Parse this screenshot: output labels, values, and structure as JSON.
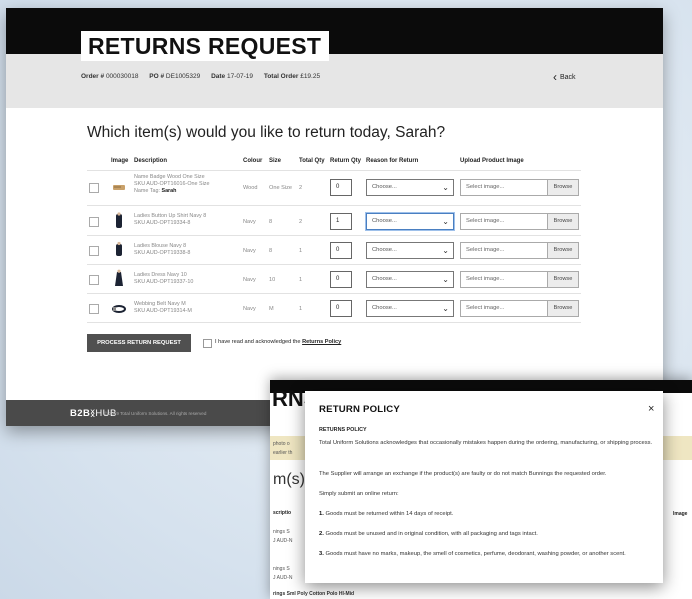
{
  "page": {
    "title": "RETURNS REQUEST"
  },
  "order_info": {
    "order_label": "Order #",
    "order_value": "000030018",
    "po_label": "PO #",
    "po_value": "DE1005329",
    "date_label": "Date",
    "date_value": "17-07-19",
    "total_label": "Total Order",
    "total_value": "£19.25"
  },
  "back_label": "Back",
  "question": "Which item(s) would you like to return today, Sarah?",
  "table": {
    "headers": [
      "Image",
      "Description",
      "Colour",
      "Size",
      "Total Qty",
      "Return Qty",
      "Reason for Return",
      "Upload Product Image"
    ],
    "rows": [
      {
        "desc1": "Name Badge Wood One Size",
        "desc2": "SKU AUD-OPT16016-One Size",
        "desc3_label": "Name Tag:",
        "desc3_value": "Sarah",
        "colour": "Wood",
        "size": "One Size",
        "total_qty": "2",
        "return_qty": "0",
        "reason": "Choose...",
        "active": false
      },
      {
        "desc1": "Ladies Button Up Shirt Navy 8",
        "desc2": "SKU AUD-OPT19334-8",
        "desc3_label": "",
        "desc3_value": "",
        "colour": "Navy",
        "size": "8",
        "total_qty": "2",
        "return_qty": "1",
        "reason": "Choose...",
        "active": true
      },
      {
        "desc1": "Ladies Blouse Navy 8",
        "desc2": "SKU AUD-OPT19338-8",
        "desc3_label": "",
        "desc3_value": "",
        "colour": "Navy",
        "size": "8",
        "total_qty": "1",
        "return_qty": "0",
        "reason": "Choose...",
        "active": false
      },
      {
        "desc1": "Ladies Dress Navy 10",
        "desc2": "SKU AUD-OPT19337-10",
        "desc3_label": "",
        "desc3_value": "",
        "colour": "Navy",
        "size": "10",
        "total_qty": "1",
        "return_qty": "0",
        "reason": "Choose...",
        "active": false
      },
      {
        "desc1": "Webbing Belt Navy M",
        "desc2": "SKU AUD-OPT19314-M",
        "desc3_label": "",
        "desc3_value": "",
        "colour": "Navy",
        "size": "M",
        "total_qty": "1",
        "return_qty": "0",
        "reason": "Choose...",
        "active": false
      }
    ],
    "upload_placeholder": "Select image...",
    "browse_label": "Browse"
  },
  "process_button": "PROCESS RETURN REQUEST",
  "ack_text": "I have read and acknowledged the",
  "ack_link": "Returns Policy",
  "footer": {
    "logo_b2b": "B2B",
    "logo_hub": "HUB",
    "copyright": "© 2019 Total Uniform Solutions. All rights reserved"
  },
  "background_window": {
    "heading_fragment": "RNS",
    "question_fragment": "m(s)",
    "col_fragment": "scriptio",
    "col_fragment_right": "Image",
    "strip_text_1": "photo o",
    "strip_text_2": "earlier th",
    "row_text_a": "nings S",
    "row_text_b": "J AUD-N",
    "bottom_text": "rings Sml Poly Cotton Polo HI-Mid"
  },
  "modal": {
    "title": "RETURN POLICY",
    "close": "×",
    "subtitle": "RETURNS POLICY",
    "paragraphs": [
      {
        "num": "",
        "text": "Total Uniform Solutions acknowledges that occasionally mistakes happen during the ordering, manufacturing, or shipping process."
      },
      {
        "num": "",
        "text": "The Supplier will arrange an exchange if the product(s) are faulty or do not match Bunnings the requested order."
      },
      {
        "num": "",
        "text": "Simply submit an online return:"
      },
      {
        "num": "1.",
        "text": "Goods must be returned within 14 days of receipt."
      },
      {
        "num": "2.",
        "text": "Goods must be unused and in original condition, with all packaging and tags intact."
      },
      {
        "num": "3.",
        "text": "Goods must have no marks, makeup, the smell of cosmetics, perfume, deodorant, washing powder, or another scent."
      }
    ]
  },
  "colors": {
    "header": "#0b0b0b",
    "info_bar": "#e6e6e6",
    "footer": "#4a4a4a",
    "button": "#505050",
    "background": "#d9e5f0"
  }
}
